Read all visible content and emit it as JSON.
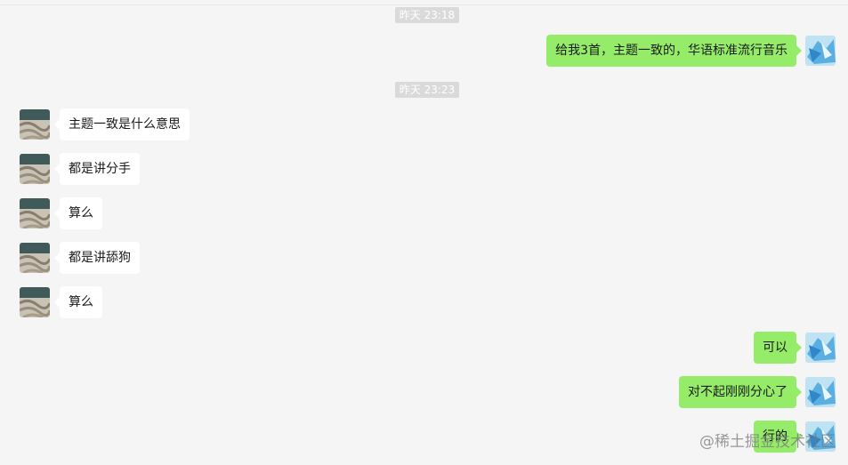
{
  "timestamps": [
    "昨天 23:18",
    "昨天 23:23"
  ],
  "messages": [
    {
      "side": "me",
      "text": "给我3首，主题一致的，华语标准流行音乐"
    },
    {
      "side": "peer",
      "text": "主题一致是什么意思"
    },
    {
      "side": "peer",
      "text": "都是讲分手"
    },
    {
      "side": "peer",
      "text": "算么"
    },
    {
      "side": "peer",
      "text": "都是讲舔狗"
    },
    {
      "side": "peer",
      "text": "算么"
    },
    {
      "side": "me",
      "text": "可以"
    },
    {
      "side": "me",
      "text": "对不起刚刚分心了"
    },
    {
      "side": "me",
      "text": "行的"
    }
  ],
  "watermark": "@稀土掘金技术社区",
  "colors": {
    "background": "#f5f5f5",
    "my_bubble": "#95ec69",
    "peer_bubble": "#ffffff",
    "timestamp_bg": "#dadada"
  }
}
